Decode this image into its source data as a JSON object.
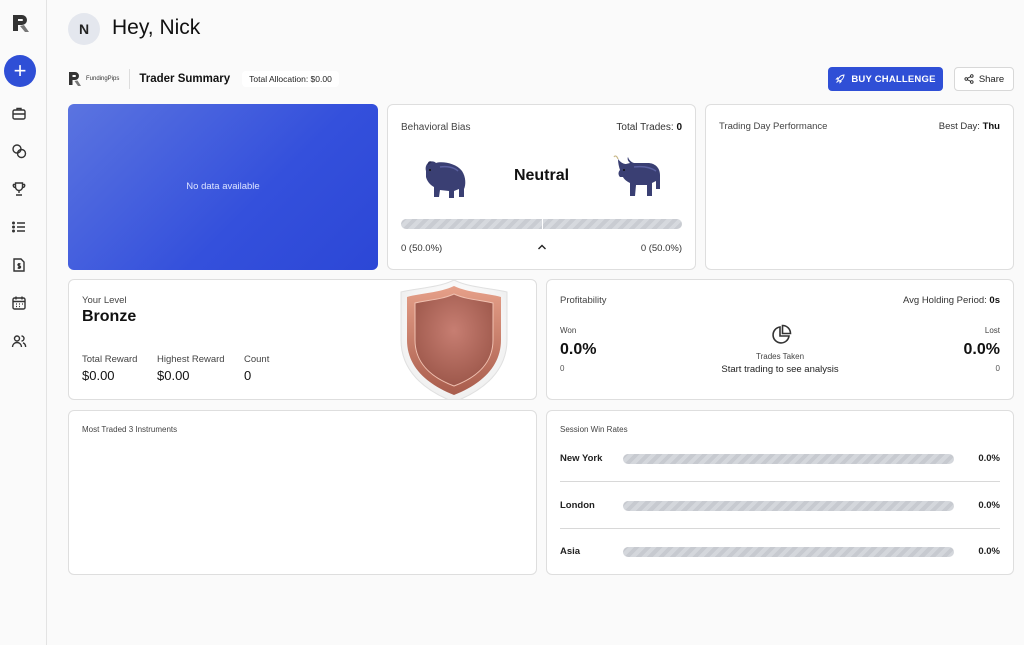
{
  "sidebar": {
    "add_label": "+",
    "icons": [
      "briefcase-icon",
      "coins-icon",
      "trophy-icon",
      "list-icon",
      "document-dollar-icon",
      "calendar-icon",
      "users-icon"
    ]
  },
  "header": {
    "avatar_initial": "N",
    "greeting": "Hey, Nick"
  },
  "summary_bar": {
    "brand_name": "FundingPips",
    "title": "Trader Summary",
    "allocation": "Total Allocation: $0.00",
    "buy_label": "BUY CHALLENGE",
    "share_label": "Share"
  },
  "empty_card": {
    "message": "No data available"
  },
  "behavioral_bias": {
    "title": "Behavioral Bias",
    "total_trades_label": "Total Trades:",
    "total_trades_value": "0",
    "status": "Neutral",
    "left_value": "0 (50.0%)",
    "right_value": "0 (50.0%)",
    "bear_fraction": 0.5
  },
  "trading_day": {
    "title": "Trading Day Performance",
    "best_day_label": "Best Day:",
    "best_day_value": "Thu"
  },
  "level": {
    "title": "Your Level",
    "name": "Bronze",
    "stats": [
      {
        "label": "Total Reward",
        "value": "$0.00"
      },
      {
        "label": "Highest Reward",
        "value": "$0.00"
      },
      {
        "label": "Count",
        "value": "0"
      }
    ]
  },
  "profitability": {
    "title": "Profitability",
    "avg_holding_label": "Avg Holding Period:",
    "avg_holding_value": "0s",
    "won_label": "Won",
    "won_pct": "0.0%",
    "won_count": "0",
    "lost_label": "Lost",
    "lost_pct": "0.0%",
    "lost_count": "0",
    "trades_taken_label": "Trades Taken",
    "empty_message": "Start trading to see analysis"
  },
  "most_traded": {
    "title": "Most Traded 3 Instruments"
  },
  "session_win_rates": {
    "title": "Session Win Rates",
    "sessions": [
      {
        "name": "New York",
        "value": "0.0%"
      },
      {
        "name": "London",
        "value": "0.0%"
      },
      {
        "name": "Asia",
        "value": "0.0%"
      }
    ]
  },
  "colors": {
    "accent": "#2f4fd6",
    "bronze": "#c0776a"
  }
}
